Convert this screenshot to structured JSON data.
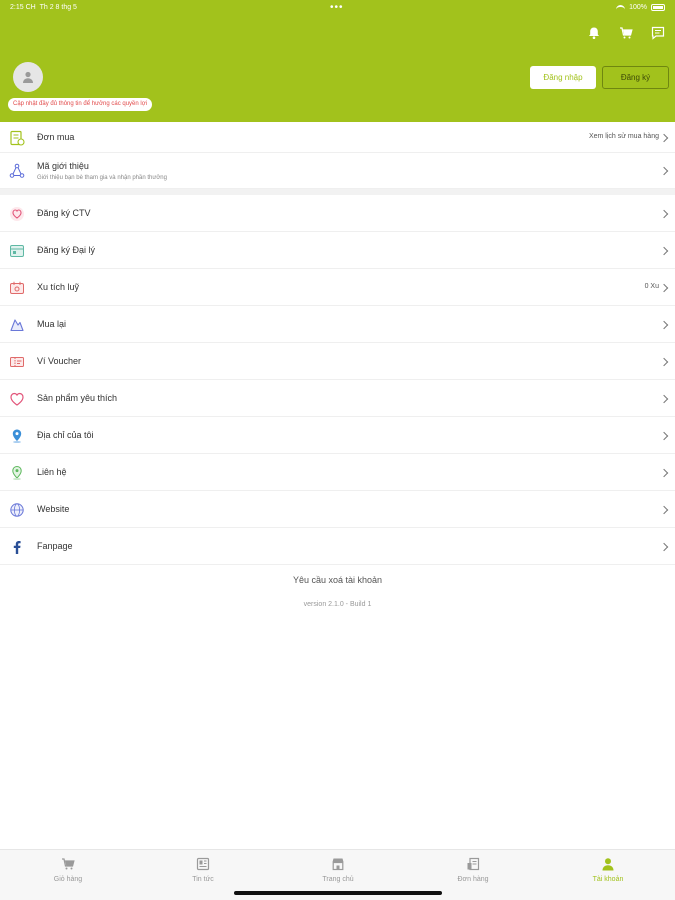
{
  "status_bar": {
    "time": "2:15 CH",
    "date": "Th 2 8 thg 5",
    "battery": "100%"
  },
  "header": {
    "icons": [
      "bell-icon",
      "cart-icon",
      "message-icon"
    ],
    "update_note": "Cập nhật đầy đủ thông tin để hưởng các quyền lợi",
    "login_label": "Đăng nhập",
    "register_label": "Đăng ký"
  },
  "orders": {
    "label": "Đơn mua",
    "history_link": "Xem lịch sử mua hàng"
  },
  "referral": {
    "label": "Mã giới thiệu",
    "sub": "Giới thiệu bạn bè tham gia và nhận phần thưởng"
  },
  "menu": [
    {
      "label": "Đăng ký CTV",
      "icon": "heart-user-icon",
      "right": ""
    },
    {
      "label": "Đăng ký Đại lý",
      "icon": "store-icon",
      "right": ""
    },
    {
      "label": "Xu tích luỹ",
      "icon": "coin-wallet-icon",
      "right": "0 Xu"
    },
    {
      "label": "Mua lại",
      "icon": "repurchase-icon",
      "right": ""
    },
    {
      "label": "Ví Voucher",
      "icon": "voucher-icon",
      "right": ""
    },
    {
      "label": "Sản phẩm yêu thích",
      "icon": "heart-icon",
      "right": ""
    },
    {
      "label": "Địa chỉ của tôi",
      "icon": "location-pin-icon",
      "right": ""
    },
    {
      "label": "Liên hệ",
      "icon": "contact-pin-icon",
      "right": ""
    },
    {
      "label": "Website",
      "icon": "globe-icon",
      "right": ""
    },
    {
      "label": "Fanpage",
      "icon": "facebook-icon",
      "right": ""
    }
  ],
  "footer": {
    "delete_account": "Yêu cầu xoá tài khoản",
    "version": "version 2.1.0 - Build 1"
  },
  "tabs": [
    {
      "label": "Giỏ hàng",
      "icon": "cart-icon",
      "active": false
    },
    {
      "label": "Tin tức",
      "icon": "news-icon",
      "active": false
    },
    {
      "label": "Trang chủ",
      "icon": "shop-icon",
      "active": false
    },
    {
      "label": "Đơn hàng",
      "icon": "orders-icon",
      "active": false
    },
    {
      "label": "Tài khoản",
      "icon": "user-icon",
      "active": true
    }
  ],
  "colors": {
    "brand": "#a2c21c",
    "warning_text": "#e24a4a"
  }
}
